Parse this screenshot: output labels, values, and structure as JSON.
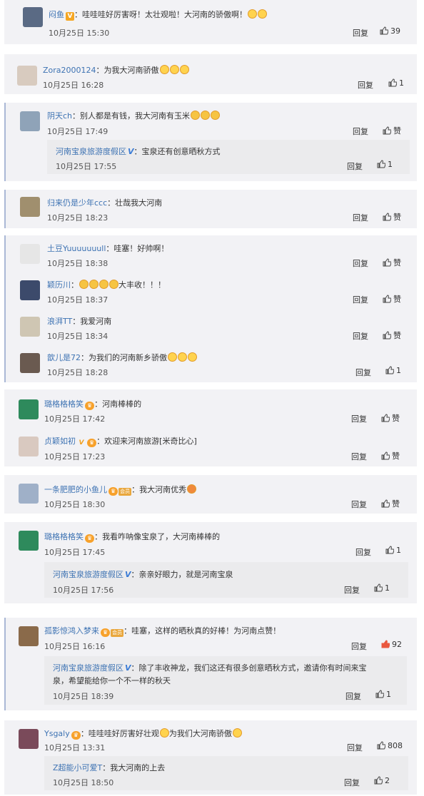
{
  "reply_label": "回复",
  "like_label": "赞",
  "colors": {
    "link": "#3e73b3",
    "card_bg": "#f2f2f5",
    "sub_bg": "#ebebed",
    "accent_like": "#e9573f"
  },
  "comments": [
    {
      "user": "闷鱼",
      "text": "哇哇哇好厉害呀！太壮观啦！大河南的骄傲啊！",
      "time": "10月25日 15:30",
      "likes": "39",
      "verified": "orange-v"
    },
    {
      "user": "Zora2000124",
      "text": "为我大河南骄傲",
      "time": "10月25日 16:28",
      "likes": "1"
    },
    {
      "user": "阴天ch",
      "text": "别人都是有钱，我大河南有玉米",
      "time": "10月25日 17:49",
      "likes": "赞",
      "reply": {
        "user": "河南宝泉旅游度假区",
        "text": "宝泉还有创意晒秋方式",
        "time": "10月25日 17:55",
        "likes": "1"
      }
    },
    {
      "user": "归来仍是少年ccc",
      "text": "壮哉我大河南",
      "time": "10月25日 18:23",
      "likes": "赞"
    },
    {
      "user": "土豆Yuuuuuuull",
      "text": "哇塞！好帅啊！",
      "time": "10月25日 18:38",
      "likes": "赞"
    },
    {
      "user": "颖历川",
      "text": "大丰收！！！",
      "time": "10月25日 18:37",
      "likes": "赞"
    },
    {
      "user": "浪湃TT",
      "text": "我爱河南",
      "time": "10月25日 18:34",
      "likes": "赞"
    },
    {
      "user": "歆儿是72",
      "text": "为我们的河南新乡骄傲",
      "time": "10月25日 18:28",
      "likes": "1"
    },
    {
      "user": "璐格格格笑",
      "text": "河南棒棒的",
      "time": "10月25日 17:42",
      "likes": "赞"
    },
    {
      "user": "贞颖如初",
      "text": "欢迎来河南旅游[米奇比心]",
      "time": "10月25日 17:23",
      "likes": "赞"
    },
    {
      "user": "一条肥肥的小鱼儿",
      "text": "我大河南优秀",
      "time": "10月25日 18:30",
      "likes": "赞"
    },
    {
      "user": "璐格格格笑",
      "text": "我看咋呐像宝泉了，大河南棒棒的",
      "time": "10月25日 17:45",
      "likes": "1",
      "reply": {
        "user": "河南宝泉旅游度假区",
        "text": "亲亲好眼力，就是河南宝泉",
        "time": "10月25日 17:56",
        "likes": "1"
      }
    },
    {
      "user": "孤影惊鸿入梦来",
      "text": "哇塞，这样的晒秋真的好棒！为河南点赞！",
      "time": "10月25日 16:16",
      "likes": "92",
      "reply": {
        "user": "河南宝泉旅游度假区",
        "text": "除了丰收神龙，我们这还有很多创意晒秋方式，邀请你有时间来宝",
        "text2": "泉，希望能给你一个不一样的秋天",
        "time": "10月25日 18:39",
        "likes": "1"
      }
    },
    {
      "user": "Ysgaly",
      "text": "哇哇哇好厉害好壮观",
      "text_b": "为我们大河南骄傲",
      "time": "10月25日 13:31",
      "likes": "808",
      "reply": {
        "user": "Z超能小可爱T",
        "text": "我大河南的上去",
        "time": "10月25日 18:50",
        "likes": "2"
      }
    }
  ]
}
